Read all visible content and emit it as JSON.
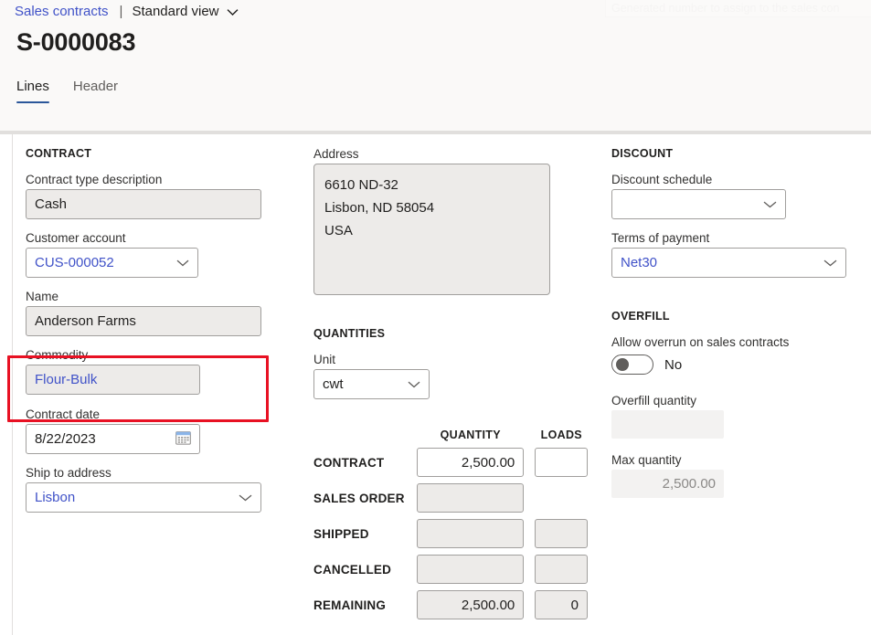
{
  "breadcrumb": {
    "link": "Sales contracts",
    "separator": "|",
    "view": "Standard view",
    "chevron_icon": "chevron-down-icon"
  },
  "page_title": "S-0000083",
  "ghost_tooltip": "Generated number to assign to the sales con",
  "tabs": [
    {
      "label": "Lines",
      "active": true
    },
    {
      "label": "Header",
      "active": false
    }
  ],
  "contract": {
    "section_title": "CONTRACT",
    "fields": [
      {
        "label": "Contract type description",
        "value": "Cash",
        "kind": "text",
        "readonly": true
      },
      {
        "label": "Customer account",
        "value": "CUS-000052",
        "kind": "combo",
        "readonly": false,
        "link": true
      },
      {
        "label": "Name",
        "value": "Anderson Farms",
        "kind": "text",
        "readonly": true
      },
      {
        "label": "Commodity",
        "value": "Flour-Bulk",
        "kind": "text",
        "readonly": true,
        "link": true
      },
      {
        "label": "Contract date",
        "value": "8/22/2023",
        "kind": "date",
        "readonly": false
      },
      {
        "label": "Ship to address",
        "value": "Lisbon",
        "kind": "combo",
        "readonly": false,
        "link": true
      }
    ]
  },
  "address": {
    "label": "Address",
    "lines": [
      "6610 ND-32",
      "Lisbon, ND 58054",
      "USA"
    ]
  },
  "quantities": {
    "section_title": "QUANTITIES",
    "unit_label": "Unit",
    "unit_value": "cwt",
    "col_quantity": "QUANTITY",
    "col_loads": "LOADS",
    "rows": [
      {
        "label": "CONTRACT",
        "quantity": "2,500.00",
        "loads": "",
        "editable": true,
        "has_loads": true
      },
      {
        "label": "SALES ORDER",
        "quantity": "",
        "loads": "",
        "editable": false,
        "has_loads": false
      },
      {
        "label": "SHIPPED",
        "quantity": "",
        "loads": "",
        "editable": false,
        "has_loads": true
      },
      {
        "label": "CANCELLED",
        "quantity": "",
        "loads": "",
        "editable": false,
        "has_loads": true
      },
      {
        "label": "REMAINING",
        "quantity": "2,500.00",
        "loads": "0",
        "editable": false,
        "has_loads": true
      }
    ]
  },
  "discount": {
    "section_title": "DISCOUNT",
    "schedule_label": "Discount schedule",
    "schedule_value": "",
    "terms_label": "Terms of payment",
    "terms_value": "Net30"
  },
  "overfill": {
    "section_title": "OVERFILL",
    "allow_label": "Allow overrun on sales contracts",
    "allow_value": "No",
    "allow_on": false,
    "overfill_qty_label": "Overfill quantity",
    "overfill_qty_value": "",
    "max_qty_label": "Max quantity",
    "max_qty_value": "2,500.00"
  },
  "annotation": {
    "highlight_target": "Commodity",
    "highlight_color": "#e81123"
  },
  "colors": {
    "link": "#4052c8",
    "tab_underline": "#2b579a",
    "field_readonly_bg": "#edebe9",
    "chrome_bg": "#faf9f8"
  }
}
